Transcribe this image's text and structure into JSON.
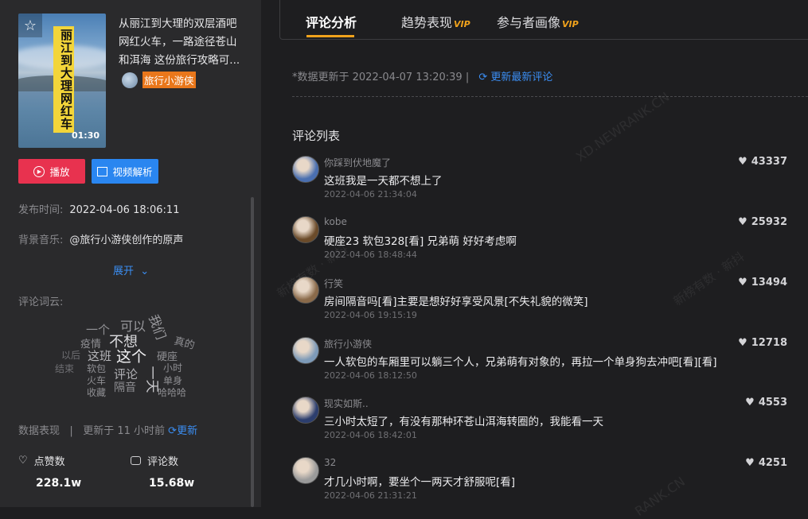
{
  "video": {
    "cover_title": "丽江到大理网红车",
    "duration": "01:30",
    "title": "从丽江到大理的双层酒吧网红火车，一路途径苍山和洱海 这份旅行攻略可...",
    "author": "旅行小游侠"
  },
  "actions": {
    "play": "播放",
    "analysis": "视频解析"
  },
  "info": {
    "publish_label": "发布时间:",
    "publish_value": "2022-04-06 18:06:11",
    "music_label": "背景音乐:",
    "music_value": "@旅行小游侠创作的原声",
    "expand": "展开"
  },
  "wordcloud": {
    "label": "评论词云:",
    "words": [
      "可以",
      "我们",
      "一个",
      "疫情",
      "不想",
      "真的",
      "以后",
      "这班",
      "这个",
      "硬座",
      "结束",
      "软包",
      "一天",
      "小时",
      "火车",
      "评论",
      "单身",
      "收藏",
      "隔音",
      "哈哈哈"
    ]
  },
  "stats": {
    "header": "数据表现",
    "divider": "|",
    "updated": "更新于 11 小时前",
    "refresh": "更新",
    "likes_label": "点赞数",
    "likes_value": "228.1w",
    "comments_label": "评论数",
    "comments_value": "15.68w"
  },
  "tabs": [
    {
      "label": "评论分析",
      "vip": ""
    },
    {
      "label": "趋势表现",
      "vip": "VIP"
    },
    {
      "label": "参与者画像",
      "vip": "VIP"
    }
  ],
  "update": {
    "text": "*数据更新于 2022-04-07 13:20:39 |",
    "link": "更新最新评论"
  },
  "list_title": "评论列表",
  "comments": [
    {
      "user": "你踩到伏地魔了",
      "text": "这班我是一天都不想上了",
      "date": "2022-04-06 21:34:04",
      "likes": "43337",
      "avatar_color": "#4a6fb0"
    },
    {
      "user": "kobe",
      "text": "硬座23 软包328[看] 兄弟萌 好好考虑啊",
      "date": "2022-04-06 18:48:44",
      "likes": "25932",
      "avatar_color": "#6b4b2a"
    },
    {
      "user": "行笑",
      "text": "房间隔音吗[看]主要是想好好享受风景[不失礼貌的微笑]",
      "date": "2022-04-06 19:15:19",
      "likes": "13494",
      "avatar_color": "#8a6a4a"
    },
    {
      "user": "旅行小游侠",
      "text": "一人软包的车厢里可以躺三个人，兄弟萌有对象的，再拉一个单身狗去冲吧[看][看]",
      "date": "2022-04-06 18:12:50",
      "likes": "12718",
      "avatar_color": "#7d9ab8"
    },
    {
      "user": "现实如斯..",
      "text": "三小时太短了，有没有那种环苍山洱海转圈的，我能看一天",
      "date": "2022-04-06 18:42:01",
      "likes": "4553",
      "avatar_color": "#2c3e6e"
    },
    {
      "user": "32",
      "text": "才几小时啊，要坐个一两天才舒服呢[看]",
      "date": "2022-04-06 21:31:21",
      "likes": "4251",
      "avatar_color": "#9a9a9a"
    }
  ],
  "watermarks": [
    "XD.NEWRANK.CN",
    "新榜有数 · 新抖",
    "RANK.CN",
    "新抖"
  ]
}
